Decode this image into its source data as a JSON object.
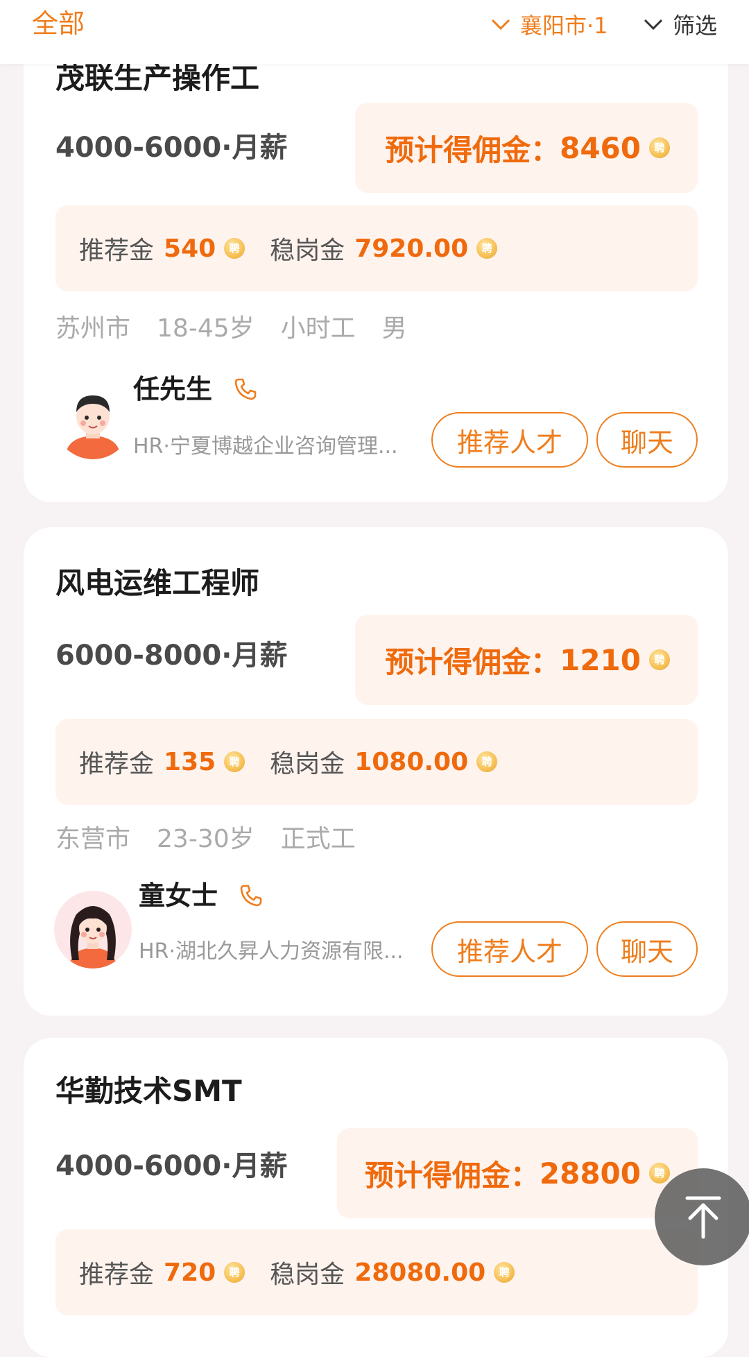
{
  "topbar": {
    "tab_all": "全部",
    "city_filter": "襄阳市·1",
    "more_filter": "筛选"
  },
  "jobs": [
    {
      "title": "茂联生产操作工",
      "salary": "4000-6000·月薪",
      "commission_label": "预计得佣金：",
      "commission_value": "8460",
      "referral_label": "推荐金",
      "referral_value": "540",
      "retention_label": "稳岗金",
      "retention_value": "7920.00",
      "tags": [
        "苏州市",
        "18-45岁",
        "小时工",
        "男"
      ],
      "hr_name": "任先生",
      "hr_company": "HR·宁夏博越企业咨询管理...",
      "recommend_btn": "推荐人才",
      "chat_btn": "聊天"
    },
    {
      "title": "风电运维工程师",
      "salary": "6000-8000·月薪",
      "commission_label": "预计得佣金：",
      "commission_value": "1210",
      "referral_label": "推荐金",
      "referral_value": "135",
      "retention_label": "稳岗金",
      "retention_value": "1080.00",
      "tags": [
        "东营市",
        "23-30岁",
        "正式工"
      ],
      "hr_name": "童女士",
      "hr_company": "HR·湖北久昇人力资源有限...",
      "recommend_btn": "推荐人才",
      "chat_btn": "聊天"
    },
    {
      "title": "华勤技术SMT",
      "salary": "4000-6000·月薪",
      "commission_label": "预计得佣金：",
      "commission_value": "28800",
      "referral_label": "推荐金",
      "referral_value": "720",
      "retention_label": "稳岗金",
      "retention_value": "28080.00"
    }
  ],
  "icons": {
    "coin": "coin-icon",
    "phone": "phone-icon",
    "chevron": "chevron-down-icon",
    "back_to_top": "arrow-up-icon"
  },
  "colors": {
    "accent": "#ef7d1c",
    "commission_bg": "#fff3ee",
    "page_bg": "#f7f2f4"
  }
}
